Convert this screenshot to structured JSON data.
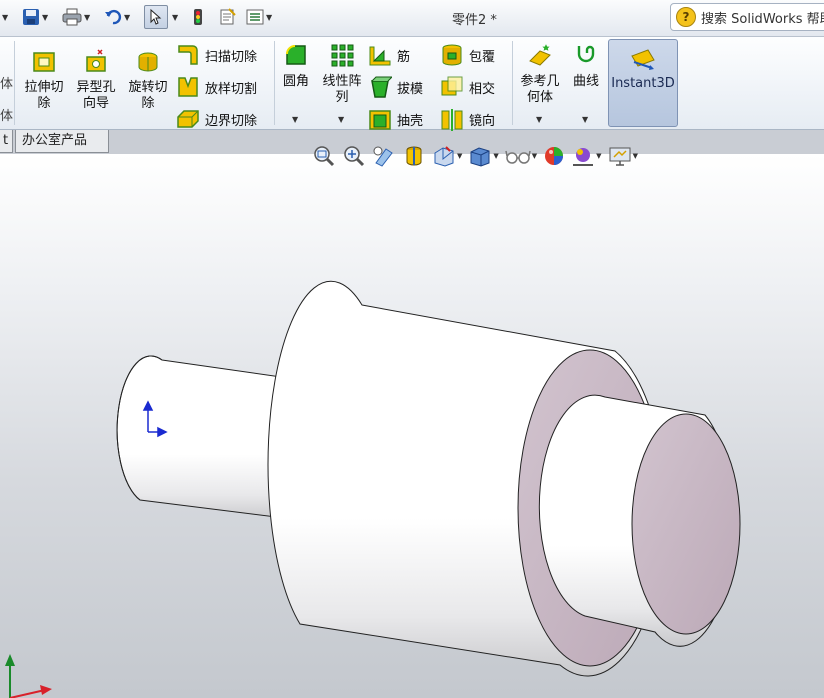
{
  "window": {
    "title": "零件2 *",
    "search_label": "搜索 SolidWorks 帮助",
    "help_icon_glyph": "?"
  },
  "ribbon": {
    "left_partial_1": "体",
    "left_partial_2": "体",
    "extrude_cut": {
      "line1": "拉伸切",
      "line2": "除"
    },
    "hole_wizard": {
      "line1": "异型孔",
      "line2": "向导"
    },
    "revolve_cut": {
      "line1": "旋转切",
      "line2": "除"
    },
    "sweep_cut": "扫描切除",
    "loft_cut": "放样切割",
    "boundary_cut": "边界切除",
    "fillet": "圆角",
    "linear_pattern": {
      "line1": "线性阵",
      "line2": "列"
    },
    "rib": "筋",
    "draft": "拔模",
    "shell": "抽壳",
    "wrap": "包覆",
    "intersect": "相交",
    "mirror": "镜向",
    "ref_geometry": {
      "line1": "参考几",
      "line2": "何体"
    },
    "curves": "曲线",
    "instant3d": "Instant3D"
  },
  "tabs": {
    "partial": "t",
    "office": "办公室产品"
  },
  "colors": {
    "accent": "#f2c200",
    "model_face": "#ffffff",
    "recess_face": "#c8b8c4",
    "triad_x": "#d8202a",
    "triad_y": "#1a8a2a",
    "origin_blue": "#1a2ad0"
  }
}
